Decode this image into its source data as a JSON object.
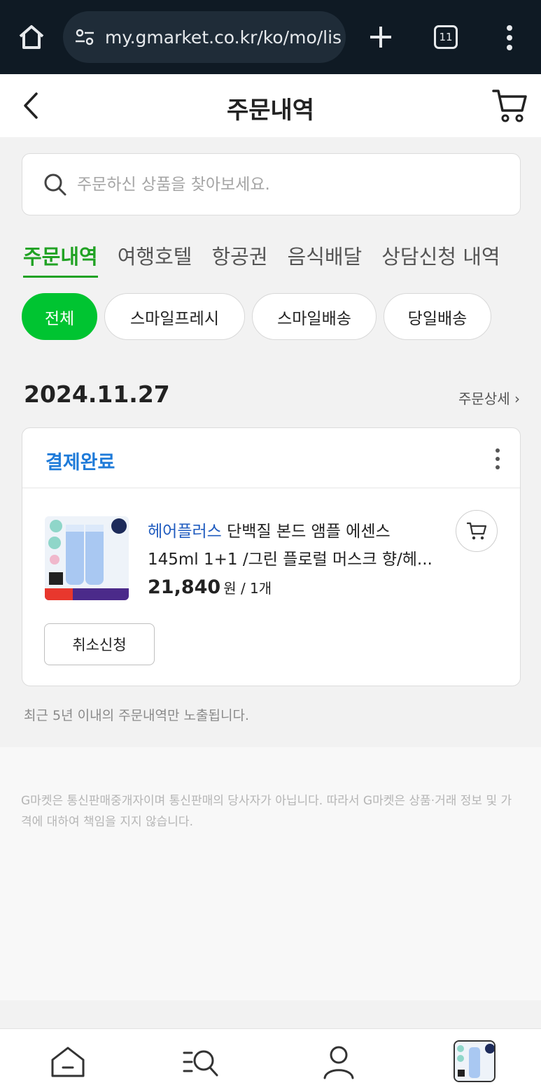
{
  "browser": {
    "url": "my.gmarket.co.kr/ko/mo/lis",
    "tab_count": "11"
  },
  "header": {
    "title": "주문내역"
  },
  "search": {
    "placeholder": "주문하신 상품을 찾아보세요."
  },
  "categories": [
    "주문내역",
    "여행호텔",
    "항공권",
    "음식배달",
    "상담신청 내역"
  ],
  "filters": [
    "전체",
    "스마일프레시",
    "스마일배송",
    "당일배송"
  ],
  "order": {
    "date": "2024.11.27",
    "detail_link": "주문상세 ›",
    "status": "결제완료",
    "brand": "헤어플러스",
    "product_name": " 단백질 본드 앰플 에센스 145ml 1+1 /그린 플로럴 머스크 향/헤...",
    "price": "21,840",
    "price_unit": "원 / 1개",
    "cancel_label": "취소신청",
    "thumb_badge": "도전! 최저가 | 오늘의 단독특가"
  },
  "notice": "최근 5년 이내의 주문내역만 노출됩니다.",
  "footer": {
    "disclaimer": "G마켓은 통신판매중개자이며 통신판매의 당사자가 아닙니다. 따라서 G마켓은 상품·거래 정보 및 가격에 대하여 책임을 지지 않습니다."
  },
  "colors": {
    "accent_green": "#00c431",
    "tab_green": "#21a224",
    "status_blue": "#1f7bd9",
    "brand_blue": "#1f5bbf",
    "browser_bar": "#0f1a24"
  },
  "icons": [
    "home-icon",
    "site-settings-icon",
    "new-tab-icon",
    "tab-switcher-icon",
    "overflow-menu-icon",
    "back-arrow-icon",
    "cart-icon",
    "search-icon",
    "more-options-icon",
    "add-to-cart-icon",
    "nav-home-icon",
    "nav-category-search-icon",
    "nav-my-icon"
  ]
}
